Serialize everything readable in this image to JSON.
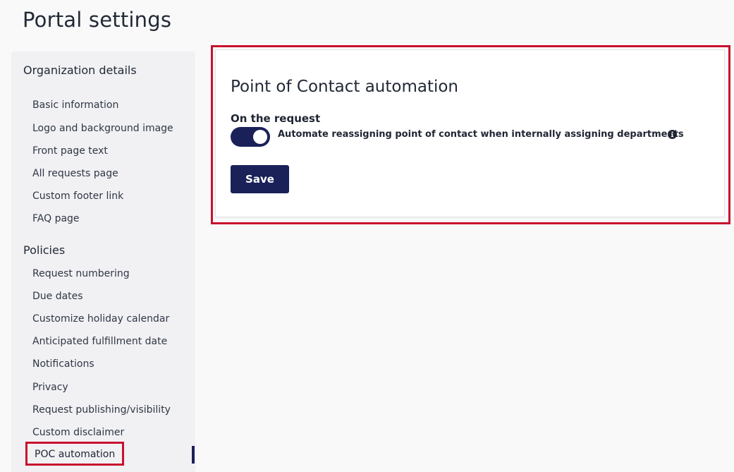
{
  "page": {
    "title": "Portal settings"
  },
  "sidebar": {
    "sections": [
      {
        "heading": "Organization details",
        "items": [
          "Basic information",
          "Logo and background image",
          "Front page text",
          "All requests page",
          "Custom footer link",
          "FAQ page"
        ]
      },
      {
        "heading": "Policies",
        "items": [
          "Request numbering",
          "Due dates",
          "Customize holiday calendar",
          "Anticipated fulfillment date",
          "Notifications",
          "Privacy",
          "Request publishing/visibility",
          "Custom disclaimer",
          "POC automation"
        ]
      }
    ],
    "active_item": "POC automation"
  },
  "content": {
    "title": "Point of Contact automation",
    "section_label": "On the request",
    "toggle": {
      "label": "Automate reassigning point of contact when internally assigning departments",
      "enabled": true,
      "info_icon": "info-icon"
    },
    "save_label": "Save"
  },
  "colors": {
    "accent": "#1a2159",
    "highlight": "#c8102e",
    "sidebar_bg": "#f1f1f4",
    "page_bg": "#f9f9fa"
  }
}
